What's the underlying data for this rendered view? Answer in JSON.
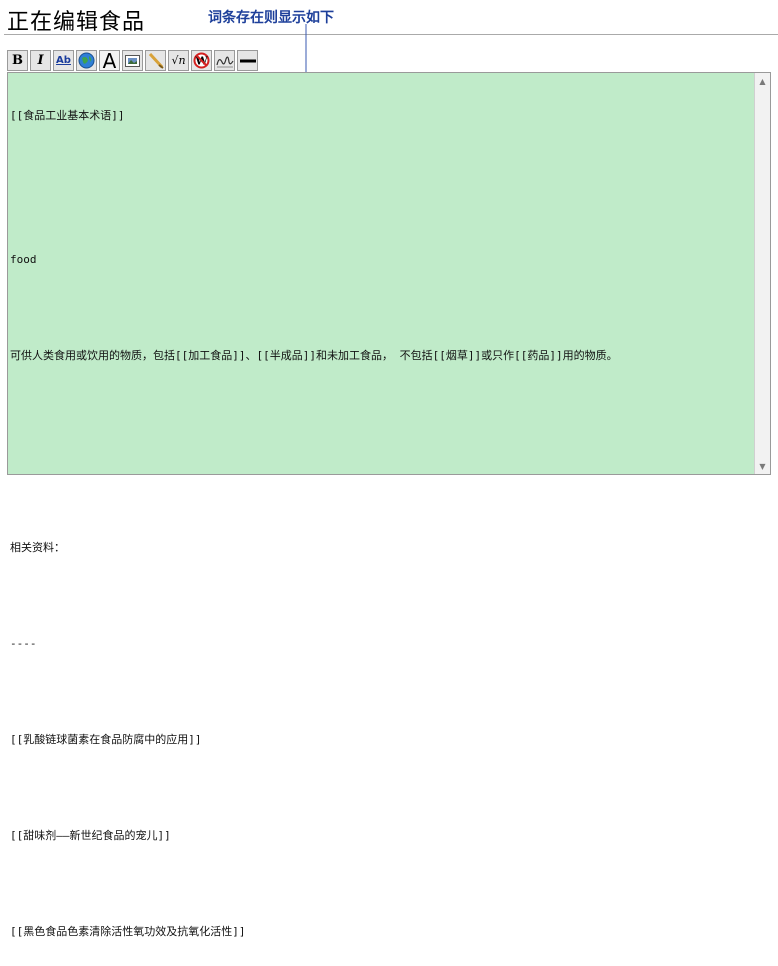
{
  "page": {
    "title": "正在编辑食品",
    "annotation": "词条存在则显示如下"
  },
  "toolbar": {
    "buttons": [
      {
        "name": "bold-button",
        "icon": "bold-icon",
        "label": "B"
      },
      {
        "name": "italic-button",
        "icon": "italic-icon",
        "label": "I"
      },
      {
        "name": "internal-link-button",
        "icon": "internal-link-icon",
        "label": "Ab"
      },
      {
        "name": "external-link-button",
        "icon": "globe-icon",
        "label": ""
      },
      {
        "name": "headline-button",
        "icon": "headline-icon",
        "label": "A"
      },
      {
        "name": "image-button",
        "icon": "image-icon",
        "label": ""
      },
      {
        "name": "media-button",
        "icon": "media-icon",
        "label": ""
      },
      {
        "name": "math-button",
        "icon": "sqrt-icon",
        "label": "√n"
      },
      {
        "name": "nowiki-button",
        "icon": "nowiki-icon",
        "label": "W"
      },
      {
        "name": "signature-button",
        "icon": "signature-icon",
        "label": ""
      },
      {
        "name": "horizontal-line-button",
        "icon": "horizontal-line-icon",
        "label": ""
      }
    ]
  },
  "editor": {
    "lines": [
      "[[食品工业基本术语]]",
      "",
      "",
      "food",
      "",
      "可供人类食用或饮用的物质，包括[[加工食品]]、[[半成品]]和未加工食品， 不包括[[烟草]]或只作[[药品]]用的物质。",
      "",
      "",
      "",
      "相关资料：",
      "",
      "----",
      "",
      "[[乳酸链球菌素在食品防腐中的应用]]",
      "",
      "[[甜味剂——新世纪食品的宠儿]]",
      "",
      "[[黑色食品色素清除活性氧功效及抗氧化活性]]"
    ]
  },
  "colors": {
    "editor_background": "#c0ebc9",
    "annotation": "#1d3f9a",
    "arrow": "#3a59b0"
  }
}
